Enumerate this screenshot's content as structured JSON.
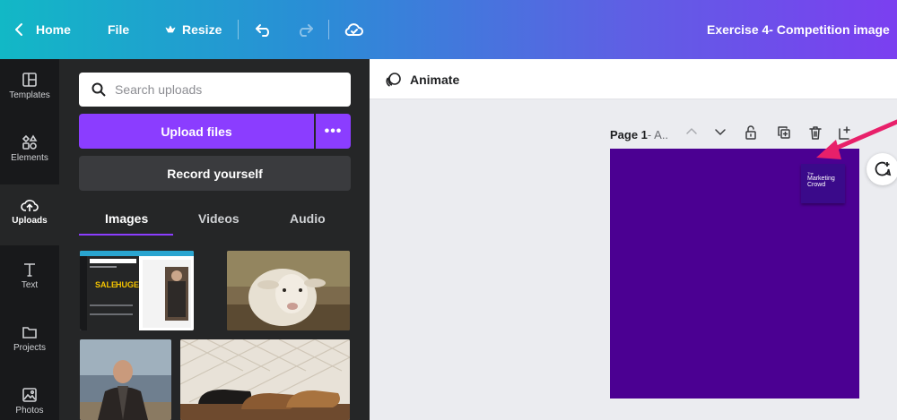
{
  "topbar": {
    "home_label": "Home",
    "file_label": "File",
    "resize_label": "Resize",
    "design_title": "Exercise 4- Competition image"
  },
  "rail": {
    "items": [
      {
        "label": "Templates",
        "icon": "templates-icon"
      },
      {
        "label": "Elements",
        "icon": "elements-icon"
      },
      {
        "label": "Uploads",
        "icon": "uploads-icon",
        "active": true
      },
      {
        "label": "Text",
        "icon": "text-icon"
      },
      {
        "label": "Projects",
        "icon": "projects-icon"
      },
      {
        "label": "Photos",
        "icon": "photos-icon"
      }
    ]
  },
  "panel": {
    "search_placeholder": "Search uploads",
    "upload_label": "Upload files",
    "more_label": "•••",
    "record_label": "Record yourself",
    "tabs": [
      {
        "label": "Images",
        "active": true
      },
      {
        "label": "Videos"
      },
      {
        "label": "Audio"
      }
    ],
    "thumbnails": [
      {
        "alt": "canva-screenshot-thumbnail",
        "caption_a": "SALE",
        "caption_b": "HUGE"
      },
      {
        "alt": "sheep-photo-thumbnail"
      },
      {
        "alt": "man-in-coat-photo-thumbnail"
      },
      {
        "alt": "leather-shoes-photo-thumbnail"
      }
    ]
  },
  "editor": {
    "animate_label": "Animate",
    "page_label_bold": "Page 1",
    "page_label_rest": " - A..",
    "logo_small_text": "The",
    "logo_text_line1": "Marketing",
    "logo_text_line2": "Crowd"
  },
  "colors": {
    "accent": "#8b3dff",
    "canvas_bg": "#4b0092",
    "arrow": "#e8206a",
    "panel_bg": "#252627",
    "rail_bg": "#18191b"
  }
}
